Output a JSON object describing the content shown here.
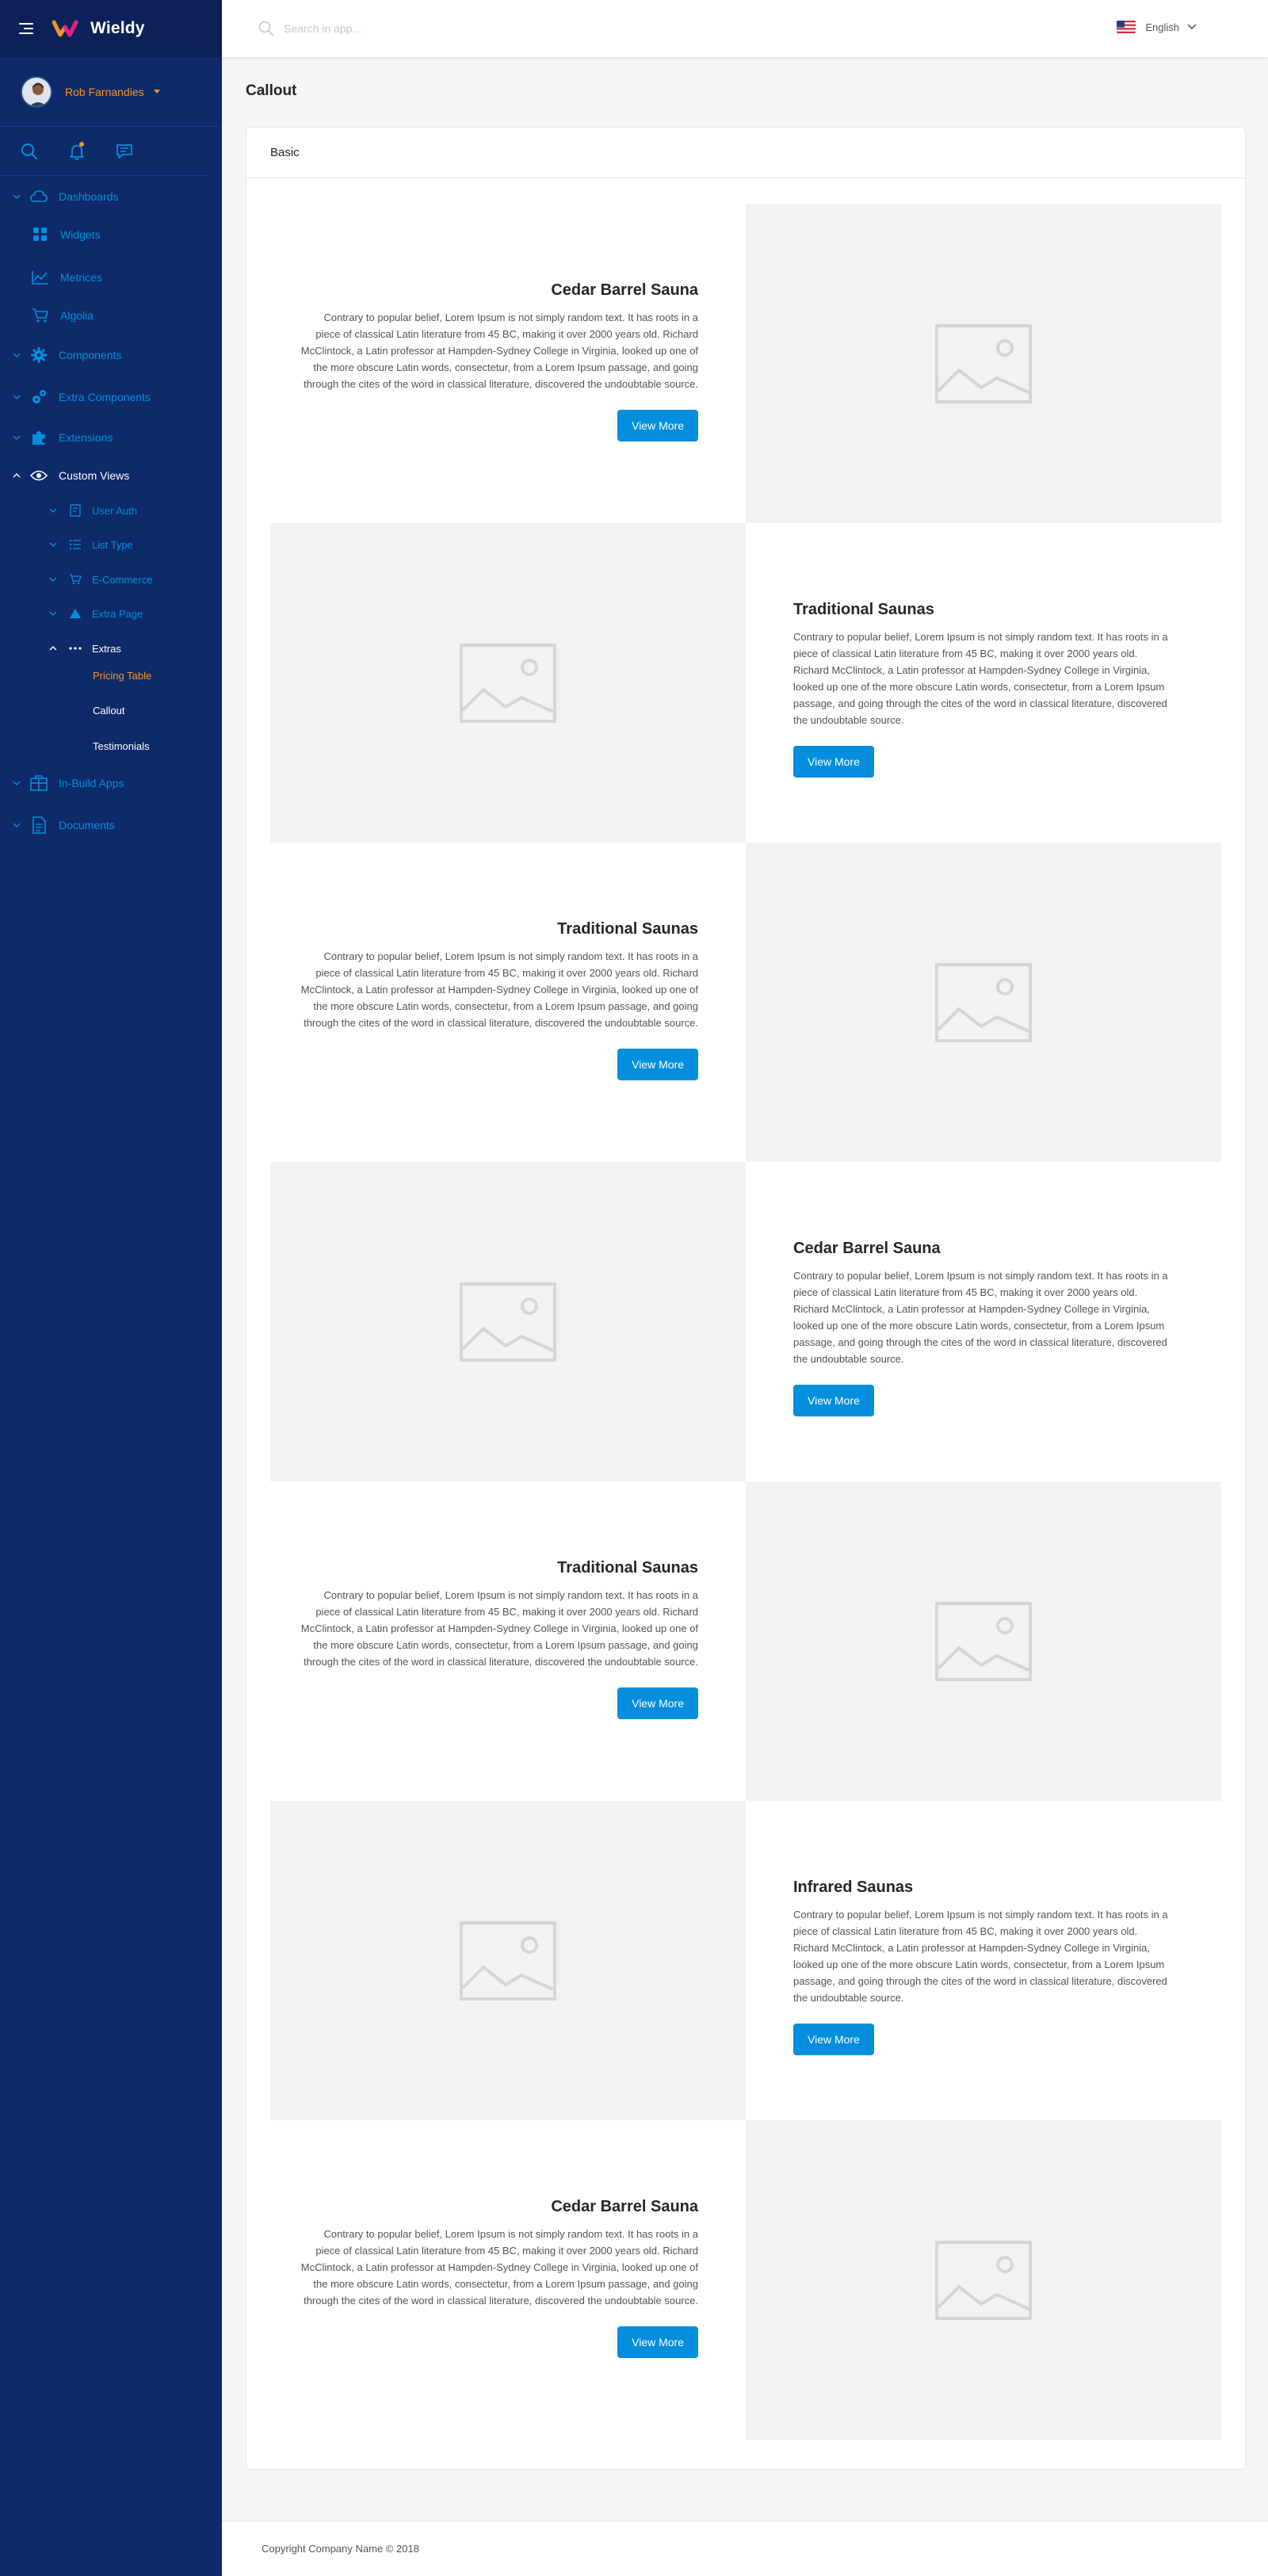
{
  "app": {
    "name": "Wieldy"
  },
  "user": {
    "name": "Rob Farnandies"
  },
  "search": {
    "placeholder": "Search in app..."
  },
  "language": {
    "label": "English"
  },
  "nav": {
    "dashboards": "Dashboards",
    "widgets": "Widgets",
    "metrices": "Metrices",
    "algolia": "Algolia",
    "components": "Components",
    "extra_components": "Extra Components",
    "extensions": "Extensions",
    "custom_views": "Custom Views",
    "user_auth": "User Auth",
    "list_type": "List Type",
    "ecommerce": "E-Commerce",
    "extra_page": "Extra Page",
    "extras": "Extras",
    "pricing_table": "Pricing Table",
    "callout": "Callout",
    "testimonials": "Testimonials",
    "in_build_apps": "In-Build Apps",
    "documents": "Documents"
  },
  "page": {
    "title": "Callout",
    "card_title": "Basic"
  },
  "callouts": [
    {
      "title": "Cedar Barrel Sauna",
      "body": "Contrary to popular belief, Lorem Ipsum is not simply random text. It has roots in a piece of classical Latin literature from 45 BC, making it over 2000 years old. Richard McClintock, a Latin professor at Hampden-Sydney College in Virginia, looked up one of the more obscure Latin words, consectetur, from a Lorem Ipsum passage, and going through the cites of the word in classical literature, discovered the undoubtable source.",
      "button": "View More"
    },
    {
      "title": "Traditional Saunas",
      "body": "Contrary to popular belief, Lorem Ipsum is not simply random text. It has roots in a piece of classical Latin literature from 45 BC, making it over 2000 years old. Richard McClintock, a Latin professor at Hampden-Sydney College in Virginia, looked up one of the more obscure Latin words, consectetur, from a Lorem Ipsum passage, and going through the cites of the word in classical literature, discovered the undoubtable source.",
      "button": "View More"
    },
    {
      "title": "Traditional Saunas",
      "body": "Contrary to popular belief, Lorem Ipsum is not simply random text. It has roots in a piece of classical Latin literature from 45 BC, making it over 2000 years old. Richard McClintock, a Latin professor at Hampden-Sydney College in Virginia, looked up one of the more obscure Latin words, consectetur, from a Lorem Ipsum passage, and going through the cites of the word in classical literature, discovered the undoubtable source.",
      "button": "View More"
    },
    {
      "title": "Cedar Barrel Sauna",
      "body": "Contrary to popular belief, Lorem Ipsum is not simply random text. It has roots in a piece of classical Latin literature from 45 BC, making it over 2000 years old. Richard McClintock, a Latin professor at Hampden-Sydney College in Virginia, looked up one of the more obscure Latin words, consectetur, from a Lorem Ipsum passage, and going through the cites of the word in classical literature, discovered the undoubtable source.",
      "button": "View More"
    },
    {
      "title": "Traditional Saunas",
      "body": "Contrary to popular belief, Lorem Ipsum is not simply random text. It has roots in a piece of classical Latin literature from 45 BC, making it over 2000 years old. Richard McClintock, a Latin professor at Hampden-Sydney College in Virginia, looked up one of the more obscure Latin words, consectetur, from a Lorem Ipsum passage, and going through the cites of the word in classical literature, discovered the undoubtable source.",
      "button": "View More"
    },
    {
      "title": "Infrared Saunas",
      "body": "Contrary to popular belief, Lorem Ipsum is not simply random text. It has roots in a piece of classical Latin literature from 45 BC, making it over 2000 years old. Richard McClintock, a Latin professor at Hampden-Sydney College in Virginia, looked up one of the more obscure Latin words, consectetur, from a Lorem Ipsum passage, and going through the cites of the word in classical literature, discovered the undoubtable source.",
      "button": "View More"
    },
    {
      "title": "Cedar Barrel Sauna",
      "body": "Contrary to popular belief, Lorem Ipsum is not simply random text. It has roots in a piece of classical Latin literature from 45 BC, making it over 2000 years old. Richard McClintock, a Latin professor at Hampden-Sydney College in Virginia, looked up one of the more obscure Latin words, consectetur, from a Lorem Ipsum passage, and going through the cites of the word in classical literature, discovered the undoubtable source.",
      "button": "View More"
    }
  ],
  "footer": {
    "copyright": "Copyright Company Name © 2018"
  },
  "colors": {
    "sidebar": "#0e2a69",
    "accent": "#038fde",
    "orange": "#f7941d"
  },
  "icons": {
    "menu": "hamburger-icon",
    "search": "search-icon",
    "notifications": "bell-icon",
    "messages": "chat-icon",
    "image_placeholder": "image-icon"
  }
}
